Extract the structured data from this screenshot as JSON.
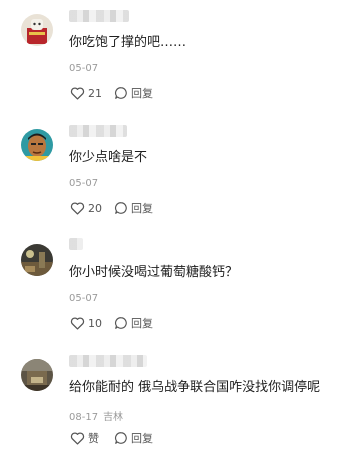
{
  "comments": [
    {
      "text": "你吃饱了撑的吧……",
      "date": "05-07",
      "location": "",
      "likes": "21",
      "reply_label": "回复",
      "avatar": "cartoon-avatar"
    },
    {
      "text": "你少点啥是不",
      "date": "05-07",
      "location": "",
      "likes": "20",
      "reply_label": "回复",
      "avatar": "cartoon-man-avatar"
    },
    {
      "text": "你小时候没喝过葡萄糖酸钙？",
      "date": "05-07",
      "location": "",
      "likes": "10",
      "reply_label": "回复",
      "avatar": "photo-avatar"
    },
    {
      "text": "给你能耐的 俄乌战争联合国咋没找你调停呢",
      "date": "08-17",
      "location": "吉林",
      "likes": "赞",
      "reply_label": "回复",
      "avatar": "photo-avatar"
    }
  ],
  "icons": {
    "like": "heart-icon",
    "reply": "comment-bubble-icon"
  },
  "colors": {
    "text": "#1f1f1f",
    "meta": "#9a9a9a",
    "action": "#555555"
  }
}
